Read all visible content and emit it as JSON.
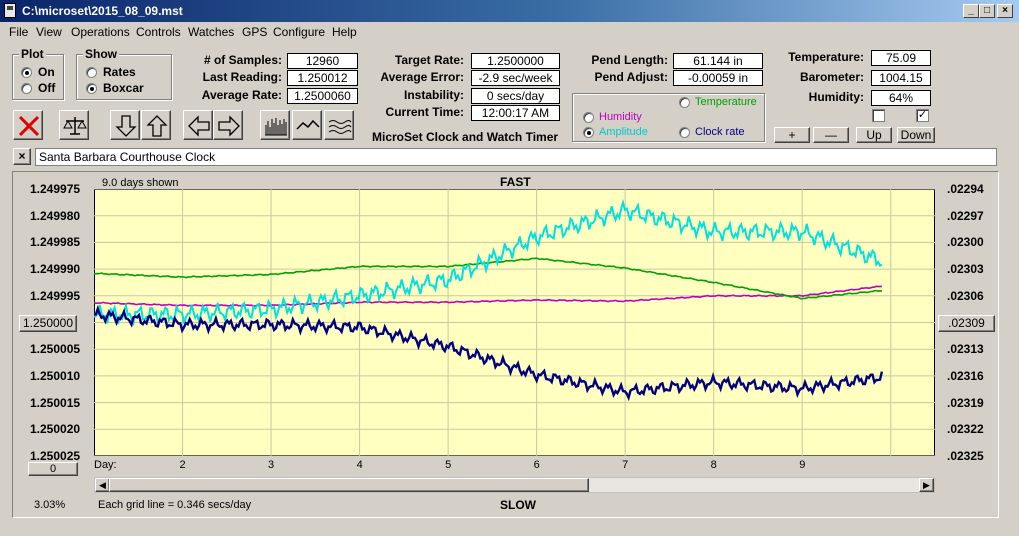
{
  "window": {
    "title": "C:\\microset\\2015_08_09.mst"
  },
  "menu": [
    "File",
    "View",
    "Operations",
    "Controls",
    "Watches",
    "GPS",
    "Configure",
    "Help"
  ],
  "plot_group": {
    "title": "Plot",
    "on": "On",
    "off": "Off",
    "selected": "On"
  },
  "show_group": {
    "title": "Show",
    "rates": "Rates",
    "boxcar": "Boxcar",
    "selected": "Boxcar"
  },
  "stats": {
    "samples_label": "# of Samples:",
    "samples": "12960",
    "last_label": "Last Reading:",
    "last": "1.250012",
    "avg_label": "Average Rate:",
    "avg": "1.2500060"
  },
  "rates": {
    "target_label": "Target Rate:",
    "target": "1.2500000",
    "error_label": "Average Error:",
    "error": "-2.9 sec/week",
    "instab_label": "Instability:",
    "instab": "0 secs/day",
    "time_label": "Current Time:",
    "time": "12:00:17 AM"
  },
  "app_caption": "MicroSet Clock and Watch Timer",
  "pend": {
    "length_label": "Pend Length:",
    "length": "61.144 in",
    "adjust_label": "Pend Adjust:",
    "adjust": "-0.00059 in"
  },
  "overlay_group": {
    "temperature": "Temperature",
    "humidity": "Humidity",
    "amplitude": "Amplitude",
    "clock_rate": "Clock rate",
    "selected": "Amplitude",
    "colors": {
      "temperature": "#00a000",
      "humidity": "#c000c0",
      "amplitude": "#00e0e0"
    }
  },
  "env": {
    "temp_label": "Temperature:",
    "temp": "75.09",
    "baro_label": "Barometer:",
    "baro": "1004.15",
    "hum_label": "Humidity:",
    "hum": "64%",
    "check1": false,
    "check2": true
  },
  "adj_buttons": {
    "plus": "+",
    "minus": "—",
    "up": "Up",
    "down": "Down"
  },
  "clock_name": "Santa Barbara Courthouse Clock",
  "toolbar_icons": [
    "cancel-icon",
    "balance-icon",
    "arrow-down-icon",
    "arrow-up-icon",
    "arrow-left-icon",
    "arrow-right-icon",
    "bar-graph-icon",
    "line-graph-icon",
    "wave-graph-icon"
  ],
  "chart": {
    "days_shown": "9.0 days shown",
    "top_label": "FAST",
    "bottom_label": "SLOW",
    "left_center": "1.250000",
    "right_center": ".02309",
    "x_start_button": "0",
    "x_first": "Day:",
    "percent": "3.03%",
    "grid_note": "Each grid line = 0.346 secs/day"
  },
  "chart_data": {
    "type": "line",
    "background": "#ffffc0",
    "x": [
      1,
      2,
      3,
      4,
      5,
      6,
      7,
      8,
      9,
      9.9
    ],
    "xtick_labels": [
      "Day:",
      "2",
      "3",
      "4",
      "5",
      "6",
      "7",
      "8",
      "9"
    ],
    "left_ticks": [
      "1.249975",
      "1.249980",
      "1.249985",
      "1.249990",
      "1.249995",
      "1.250000",
      "1.250005",
      "1.250010",
      "1.250015",
      "1.250020",
      "1.250025"
    ],
    "right_ticks": [
      ".02294",
      ".02297",
      ".02300",
      ".02303",
      ".02306",
      ".02309",
      ".02313",
      ".02316",
      ".02319",
      ".02322",
      ".02325"
    ],
    "ylim": [
      1.249975,
      1.250025
    ],
    "series": [
      {
        "name": "Clock rate",
        "color": "#000080",
        "values": [
          1.2499985,
          1.2500004,
          1.2500004,
          1.2500009,
          1.2500045,
          1.2500098,
          1.250013,
          1.2500112,
          1.2500124,
          1.2500102
        ]
      },
      {
        "name": "Amplitude",
        "color": "#00e0e0",
        "values": [
          1.2499985,
          1.2499985,
          1.2499975,
          1.249995,
          1.249992,
          1.249984,
          1.249979,
          1.249983,
          1.249983,
          1.2499885
        ]
      },
      {
        "name": "Temperature",
        "color": "#00a000",
        "values": [
          1.2499908,
          1.2499915,
          1.249991,
          1.2499895,
          1.2499895,
          1.249988,
          1.2499898,
          1.2499925,
          1.2499955,
          1.249994
        ]
      },
      {
        "name": "Humidity",
        "color": "#c000c0",
        "values": [
          1.2499963,
          1.2499968,
          1.2499968,
          1.2499962,
          1.2499962,
          1.2499958,
          1.249996,
          1.249995,
          1.249995,
          1.2499932
        ]
      }
    ]
  }
}
